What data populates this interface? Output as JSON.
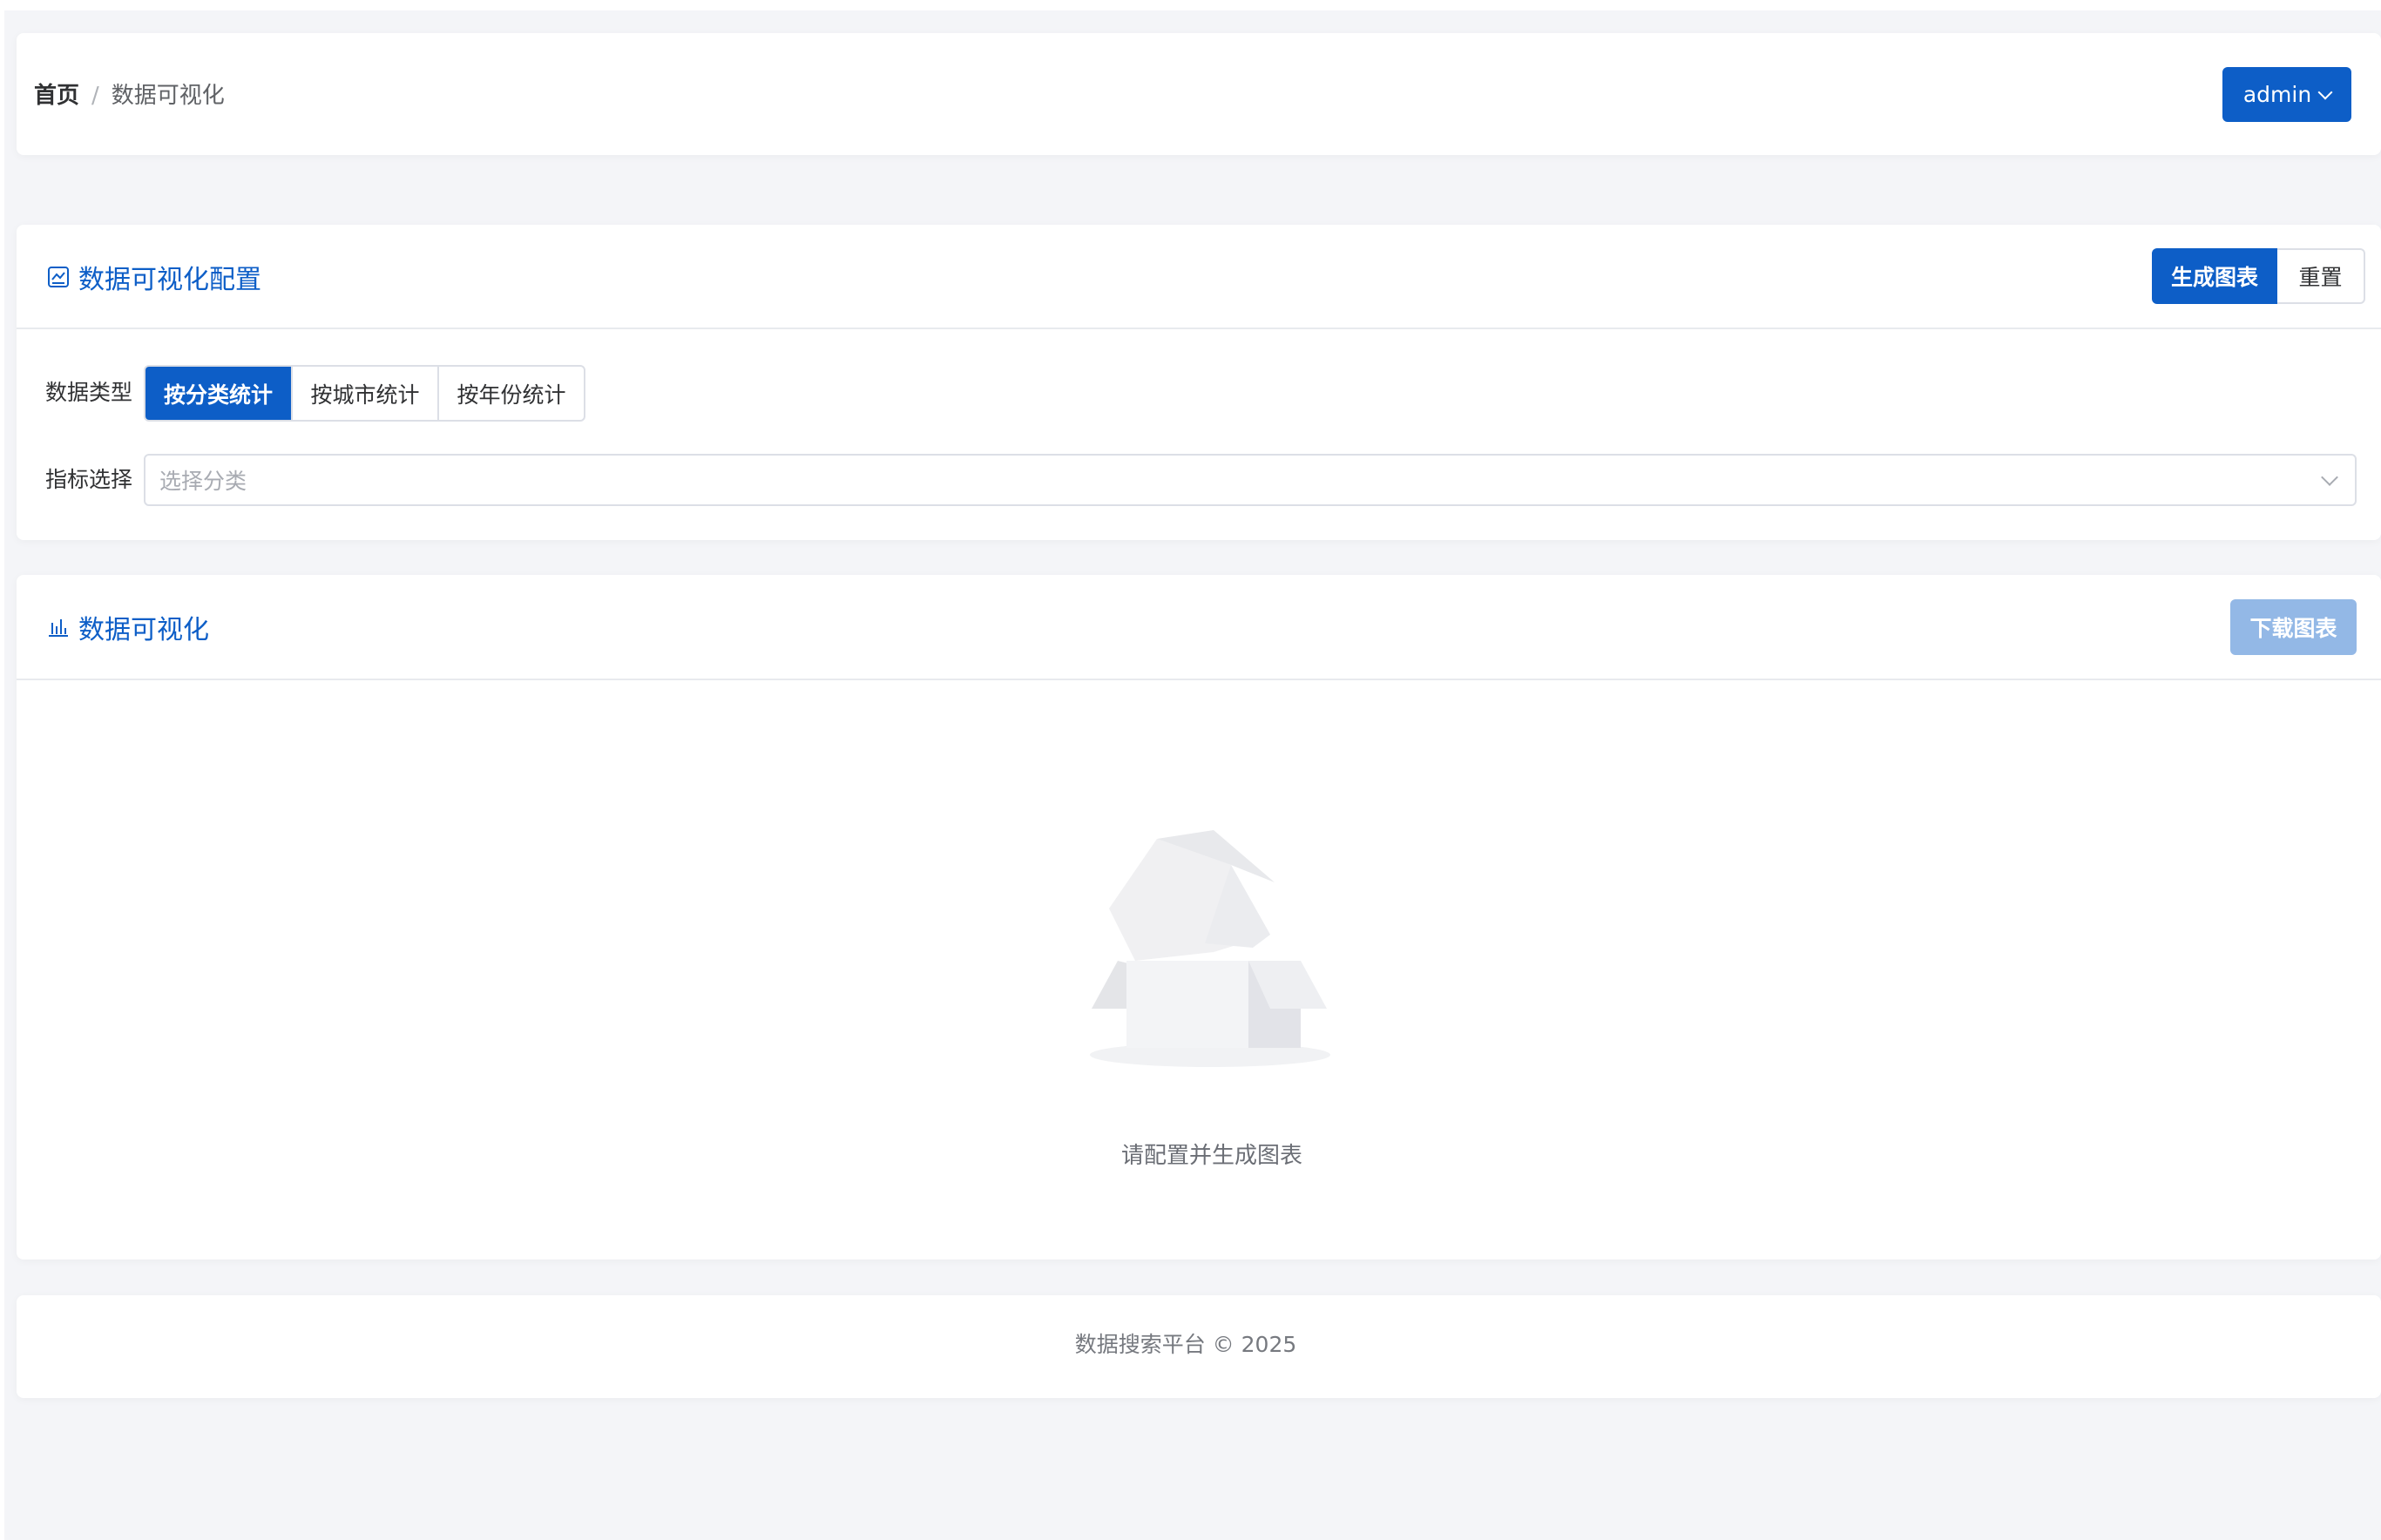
{
  "header": {
    "breadcrumb": {
      "home": "首页",
      "separator": "/",
      "current": "数据可视化"
    },
    "user": {
      "name": "admin",
      "icon": "chevron-down-icon"
    }
  },
  "config": {
    "title": "数据可视化配置",
    "title_icon": "line-chart-icon",
    "generate_label": "生成图表",
    "reset_label": "重置",
    "data_type_label": "数据类型",
    "data_types": [
      {
        "label": "按分类统计",
        "active": true
      },
      {
        "label": "按城市统计",
        "active": false
      },
      {
        "label": "按年份统计",
        "active": false
      }
    ],
    "metric_label": "指标选择",
    "metric_placeholder": "选择分类"
  },
  "chart": {
    "title": "数据可视化",
    "title_icon": "bar-chart-icon",
    "download_label": "下载图表",
    "download_enabled": false,
    "empty_icon": "empty-box-icon",
    "empty_text": "请配置并生成图表"
  },
  "footer": {
    "text": "数据搜索平台 © 2025"
  },
  "colors": {
    "primary": "#0d5ec7",
    "primary_disabled": "#93b8e6",
    "background": "#f4f5f8"
  }
}
